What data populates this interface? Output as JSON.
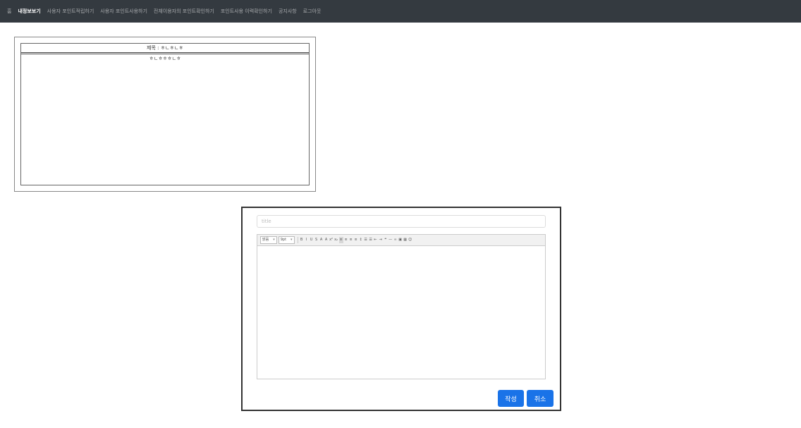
{
  "nav": {
    "items": [
      {
        "label": "홈"
      },
      {
        "label": "내정보보기"
      },
      {
        "label": "사용자 포인트적립하기"
      },
      {
        "label": "사용자 포인트사용하기"
      },
      {
        "label": "전체이용자의 포인트확인하기"
      },
      {
        "label": "포인트사용 이력확인하기"
      },
      {
        "label": "공지사항"
      },
      {
        "label": "로그아웃"
      }
    ],
    "active_index": 1,
    "bg_color": "#343a40"
  },
  "post": {
    "title": "제목 : ㅎㄴㅎㄴㅎ",
    "body": "ㅎㄴㅎㅎㅎㄴㅎ"
  },
  "write_form": {
    "title_placeholder": "title",
    "toolbar": {
      "font_select": "맑음",
      "size_select": "9pt"
    },
    "submit_label": "작성",
    "cancel_label": "취소",
    "accent_color": "#1a73e8"
  }
}
